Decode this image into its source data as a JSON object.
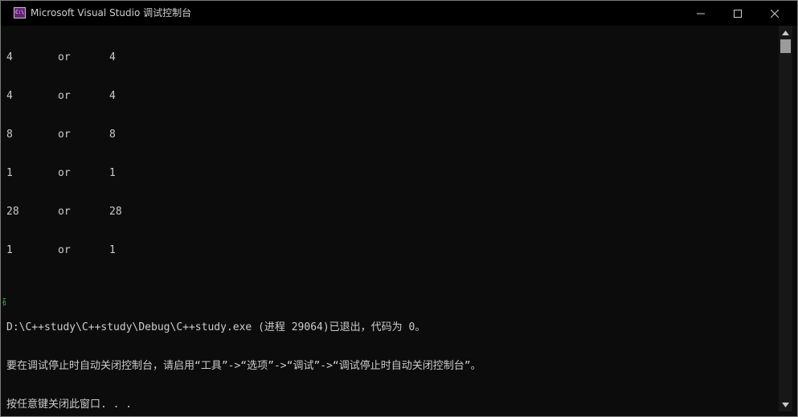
{
  "window": {
    "title": "Microsoft Visual Studio 调试控制台",
    "icon_label": "C:\\"
  },
  "controls": {
    "minimize_icon": "minimize-icon",
    "maximize_icon": "maximize-icon",
    "close_icon": "close-icon"
  },
  "console": {
    "rows": [
      {
        "a": "4",
        "b": "or",
        "c": "4"
      },
      {
        "a": "4",
        "b": "or",
        "c": "4"
      },
      {
        "a": "8",
        "b": "or",
        "c": "8"
      },
      {
        "a": "1",
        "b": "or",
        "c": "1"
      },
      {
        "a": "28",
        "b": "or",
        "c": "28"
      },
      {
        "a": "1",
        "b": "or",
        "c": "1"
      }
    ],
    "exit_line": "D:\\C++study\\C++study\\Debug\\C++study.exe (进程 29064)已退出，代码为 0。",
    "hint_line": "要在调试停止时自动关闭控制台，请启用“工具”->“选项”->“调试”->“调试停止时自动关闭控制台”。",
    "press_key_line": "按任意键关闭此窗口. . .",
    "stray_glyph": "码"
  },
  "colors": {
    "background": "#0c0c0c",
    "text": "#cccccc",
    "titlebar": "#000000",
    "stray_text": "#3fa63f"
  }
}
